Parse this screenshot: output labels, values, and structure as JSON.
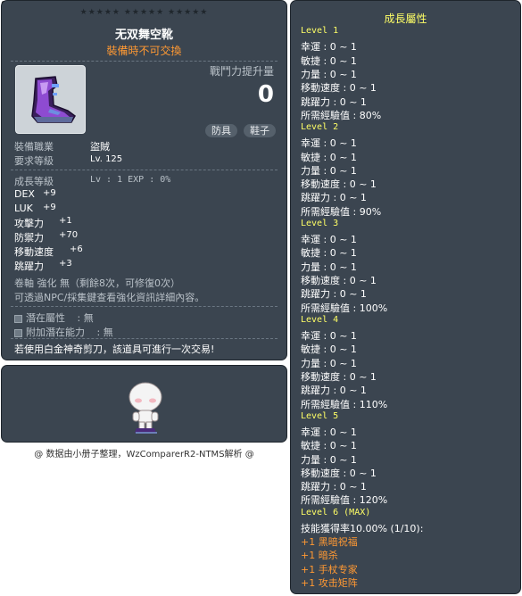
{
  "item_id": "01072552",
  "tooltip": {
    "stars": "★★★★★  ★★★★★  ★★★★★",
    "title": "无双舞空靴",
    "untradeable": "裝備時不可交換",
    "power_label": "戰鬥力提升量",
    "power_value": "0",
    "tags": [
      "防具",
      "鞋子"
    ],
    "req_job_label": "裝備職業",
    "req_job_value": "盜賊",
    "req_level_label": "要求等級",
    "req_level_value": "Lv. 125",
    "growth_label": "成長等級",
    "growth_value": "Lv  :  1   EXP  :  0%",
    "stats": [
      {
        "label": "DEX",
        "value": "+9"
      },
      {
        "label": "LUK",
        "value": "+9"
      },
      {
        "label": "攻擊力",
        "value": "+1"
      },
      {
        "label": "防禦力",
        "value": "+70"
      },
      {
        "label": "移動速度",
        "value": "+6"
      },
      {
        "label": "跳躍力",
        "value": "+3"
      }
    ],
    "upgrade_line": "卷軸 強化 無（剩餘8次，可修復0次）",
    "info_line": "可透過NPC/採集鍵查看強化資訊詳細內容。",
    "potential_label": "潛在屬性",
    "potential_value": ":  無",
    "addl_potential_label": "附加潛在能力",
    "addl_potential_value": ":  無",
    "scissors_note": "若使用白金神奇剪刀，該道具可進行一次交易!"
  },
  "footer": "@ 数据由小册子整理，WzComparerR2-NTMS解析 @",
  "growth": {
    "title": "成長屬性",
    "levels": [
      {
        "name": "Level 1",
        "lines": [
          "幸運 : 0 ~ 1",
          "敏捷 : 0 ~ 1",
          "力量 : 0 ~ 1",
          "移動速度 : 0 ~ 1",
          "跳躍力 : 0 ~ 1",
          "所需經驗值 : 80%"
        ]
      },
      {
        "name": "Level 2",
        "lines": [
          "幸運 : 0 ~ 1",
          "敏捷 : 0 ~ 1",
          "力量 : 0 ~ 1",
          "移動速度 : 0 ~ 1",
          "跳躍力 : 0 ~ 1",
          "所需經驗值 : 90%"
        ]
      },
      {
        "name": "Level 3",
        "lines": [
          "幸運 : 0 ~ 1",
          "敏捷 : 0 ~ 1",
          "力量 : 0 ~ 1",
          "移動速度 : 0 ~ 1",
          "跳躍力 : 0 ~ 1",
          "所需經驗值 : 100%"
        ]
      },
      {
        "name": "Level 4",
        "lines": [
          "幸運 : 0 ~ 1",
          "敏捷 : 0 ~ 1",
          "力量 : 0 ~ 1",
          "移動速度 : 0 ~ 1",
          "跳躍力 : 0 ~ 1",
          "所需經驗值 : 110%"
        ]
      },
      {
        "name": "Level 5",
        "lines": [
          "幸運 : 0 ~ 1",
          "敏捷 : 0 ~ 1",
          "力量 : 0 ~ 1",
          "移動速度 : 0 ~ 1",
          "跳躍力 : 0 ~ 1",
          "所需經驗值 : 120%"
        ]
      }
    ],
    "max_level": {
      "name": "Level 6 (MAX)",
      "skill_rate": "技能獲得率10.00% (1/10):",
      "skills": [
        "+1 黑暗祝福",
        "+1 暗杀",
        "+1 手杖专家",
        "+1 攻击矩阵"
      ]
    }
  },
  "colors": {
    "panel_bg": "#3b4550",
    "highlight_yellow": "#ffff66",
    "orange": "#ff9933"
  }
}
